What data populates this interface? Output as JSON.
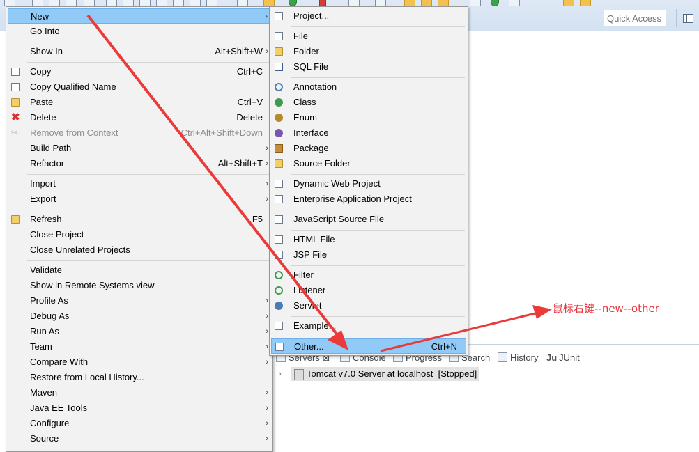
{
  "toolbar": {
    "quick_access_placeholder": "Quick Access"
  },
  "context_menu": {
    "items": [
      {
        "label": "New",
        "shortcut": "",
        "submenu": true,
        "highlighted": true
      },
      {
        "label": "Go Into",
        "shortcut": "",
        "submenu": false
      },
      {
        "label": "Show In",
        "shortcut": "Alt+Shift+W",
        "submenu": true
      },
      {
        "label": "Copy",
        "shortcut": "Ctrl+C",
        "submenu": false
      },
      {
        "label": "Copy Qualified Name",
        "shortcut": "",
        "submenu": false
      },
      {
        "label": "Paste",
        "shortcut": "Ctrl+V",
        "submenu": false
      },
      {
        "label": "Delete",
        "shortcut": "Delete",
        "submenu": false
      },
      {
        "label": "Remove from Context",
        "shortcut": "Ctrl+Alt+Shift+Down",
        "submenu": false,
        "disabled": true
      },
      {
        "label": "Build Path",
        "shortcut": "",
        "submenu": true
      },
      {
        "label": "Refactor",
        "shortcut": "Alt+Shift+T",
        "submenu": true
      },
      {
        "label": "Import",
        "shortcut": "",
        "submenu": true
      },
      {
        "label": "Export",
        "shortcut": "",
        "submenu": true
      },
      {
        "label": "Refresh",
        "shortcut": "F5",
        "submenu": false
      },
      {
        "label": "Close Project",
        "shortcut": "",
        "submenu": false
      },
      {
        "label": "Close Unrelated Projects",
        "shortcut": "",
        "submenu": false
      },
      {
        "label": "Validate",
        "shortcut": "",
        "submenu": false
      },
      {
        "label": "Show in Remote Systems view",
        "shortcut": "",
        "submenu": false
      },
      {
        "label": "Profile As",
        "shortcut": "",
        "submenu": true
      },
      {
        "label": "Debug As",
        "shortcut": "",
        "submenu": true
      },
      {
        "label": "Run As",
        "shortcut": "",
        "submenu": true
      },
      {
        "label": "Team",
        "shortcut": "",
        "submenu": true
      },
      {
        "label": "Compare With",
        "shortcut": "",
        "submenu": true
      },
      {
        "label": "Restore from Local History...",
        "shortcut": "",
        "submenu": false
      },
      {
        "label": "Maven",
        "shortcut": "",
        "submenu": true
      },
      {
        "label": "Java EE Tools",
        "shortcut": "",
        "submenu": true
      },
      {
        "label": "Configure",
        "shortcut": "",
        "submenu": true
      },
      {
        "label": "Source",
        "shortcut": "",
        "submenu": true
      }
    ]
  },
  "new_submenu": {
    "items": [
      {
        "label": "Project...",
        "shortcut": ""
      },
      {
        "label": "File",
        "shortcut": ""
      },
      {
        "label": "Folder",
        "shortcut": ""
      },
      {
        "label": "SQL File",
        "shortcut": ""
      },
      {
        "label": "Annotation",
        "shortcut": ""
      },
      {
        "label": "Class",
        "shortcut": ""
      },
      {
        "label": "Enum",
        "shortcut": ""
      },
      {
        "label": "Interface",
        "shortcut": ""
      },
      {
        "label": "Package",
        "shortcut": ""
      },
      {
        "label": "Source Folder",
        "shortcut": ""
      },
      {
        "label": "Dynamic Web Project",
        "shortcut": ""
      },
      {
        "label": "Enterprise Application Project",
        "shortcut": ""
      },
      {
        "label": "JavaScript Source File",
        "shortcut": ""
      },
      {
        "label": "HTML File",
        "shortcut": ""
      },
      {
        "label": "JSP File",
        "shortcut": ""
      },
      {
        "label": "Filter",
        "shortcut": ""
      },
      {
        "label": "Listener",
        "shortcut": ""
      },
      {
        "label": "Servlet",
        "shortcut": ""
      },
      {
        "label": "Example...",
        "shortcut": ""
      },
      {
        "label": "Other...",
        "shortcut": "Ctrl+N",
        "highlighted": true
      }
    ]
  },
  "bottom_panel": {
    "tabs": [
      "Servers",
      "Console",
      "Progress",
      "Search",
      "History",
      "JUnit"
    ],
    "server_entry": "Tomcat v7.0 Server at localhost  [Stopped]"
  },
  "annotation": {
    "text": "鼠标右键--new--other",
    "color": "#e8323a"
  },
  "colors": {
    "highlight": "#91c9f7",
    "menu_bg": "#f2f2f2",
    "toolbar_bg": "#d8e4f2"
  }
}
